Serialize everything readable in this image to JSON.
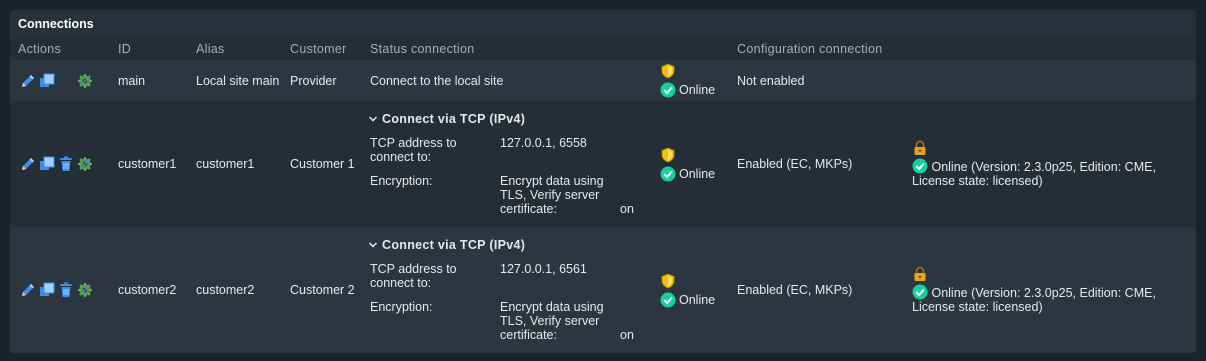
{
  "panel": {
    "title": "Connections"
  },
  "columns": {
    "actions": "Actions",
    "id": "ID",
    "alias": "Alias",
    "customer": "Customer",
    "status": "Status connection",
    "config": "Configuration connection"
  },
  "rows": [
    {
      "id": "main",
      "alias": "Local site main",
      "customer": "Provider",
      "status_text": "Connect to the local site",
      "status_state": "Online",
      "config_text": "Not enabled"
    },
    {
      "id": "customer1",
      "alias": "customer1",
      "customer": "Customer 1",
      "tcp_heading": "Connect via TCP (IPv4)",
      "tcp_label": "TCP address to connect to:",
      "tcp_value": "127.0.0.1, 6558",
      "enc_label": "Encryption:",
      "enc_value": "Encrypt data using TLS, Verify server certificate:",
      "enc_on": "on",
      "status_state": "Online",
      "config_text": "Enabled (EC, MKPs)",
      "config_status": "Online (Version: 2.3.0p25, Edition: CME, License state: licensed)"
    },
    {
      "id": "customer2",
      "alias": "customer2",
      "customer": "Customer 2",
      "tcp_heading": "Connect via TCP (IPv4)",
      "tcp_label": "TCP address to connect to:",
      "tcp_value": "127.0.0.1, 6561",
      "enc_label": "Encryption:",
      "enc_value": "Encrypt data using TLS, Verify server certificate:",
      "enc_on": "on",
      "status_state": "Online",
      "config_text": "Enabled (EC, MKPs)",
      "config_status": "Online (Version: 2.3.0p25, Edition: CME, License state: licensed)"
    }
  ],
  "colors": {
    "online": "#15d1a0",
    "shield": "#f2c200",
    "lock": "#e8a020",
    "edit": "#3b8eea"
  }
}
